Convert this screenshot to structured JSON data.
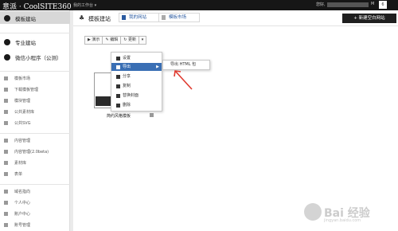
{
  "topbar": {
    "logo": "意派 · CoolSITE360",
    "workspace": "我的工作台 ▾",
    "user_greeting": "您好,",
    "counter_label": "M",
    "counter_value": "6"
  },
  "sidebar": {
    "items": [
      {
        "label": "模板建站"
      },
      {
        "label": "专业建站"
      },
      {
        "label": "微信小程序（公测）"
      },
      {
        "label": "模板市场"
      },
      {
        "label": "下载模板管理"
      },
      {
        "label": "模块管理"
      },
      {
        "label": "公共素材库"
      },
      {
        "label": "公共SVG"
      },
      {
        "label": "内容管理"
      },
      {
        "label": "内容管理(2.0beta)"
      },
      {
        "label": "素材库"
      },
      {
        "label": "表单"
      },
      {
        "label": "域名指向"
      },
      {
        "label": "个人中心"
      },
      {
        "label": "账户中心"
      },
      {
        "label": "账号管理"
      }
    ]
  },
  "header": {
    "title": "模板建站",
    "tab_my": "我的网站",
    "tab_market": "模板市场",
    "new_site": "+ 新建空白网站"
  },
  "toolbar": {
    "preview": "▶ 演示",
    "edit": "✎ 编辑",
    "update": "↻ 更新",
    "caret": "▾"
  },
  "menu": {
    "items": [
      {
        "label": "设置"
      },
      {
        "label": "导出"
      },
      {
        "label": "分享"
      },
      {
        "label": "复制"
      },
      {
        "label": "替换封面"
      },
      {
        "label": "删除"
      }
    ],
    "submenu": "导出 HTML 包"
  },
  "template": {
    "name": "简约风格模板"
  },
  "watermark": {
    "text": "Bai 经验",
    "sub": "jingyan.baidu.com"
  },
  "colors": {
    "accent": "#3a6fb4",
    "dark": "#1f1f1f",
    "arrow": "#e03a2f"
  }
}
